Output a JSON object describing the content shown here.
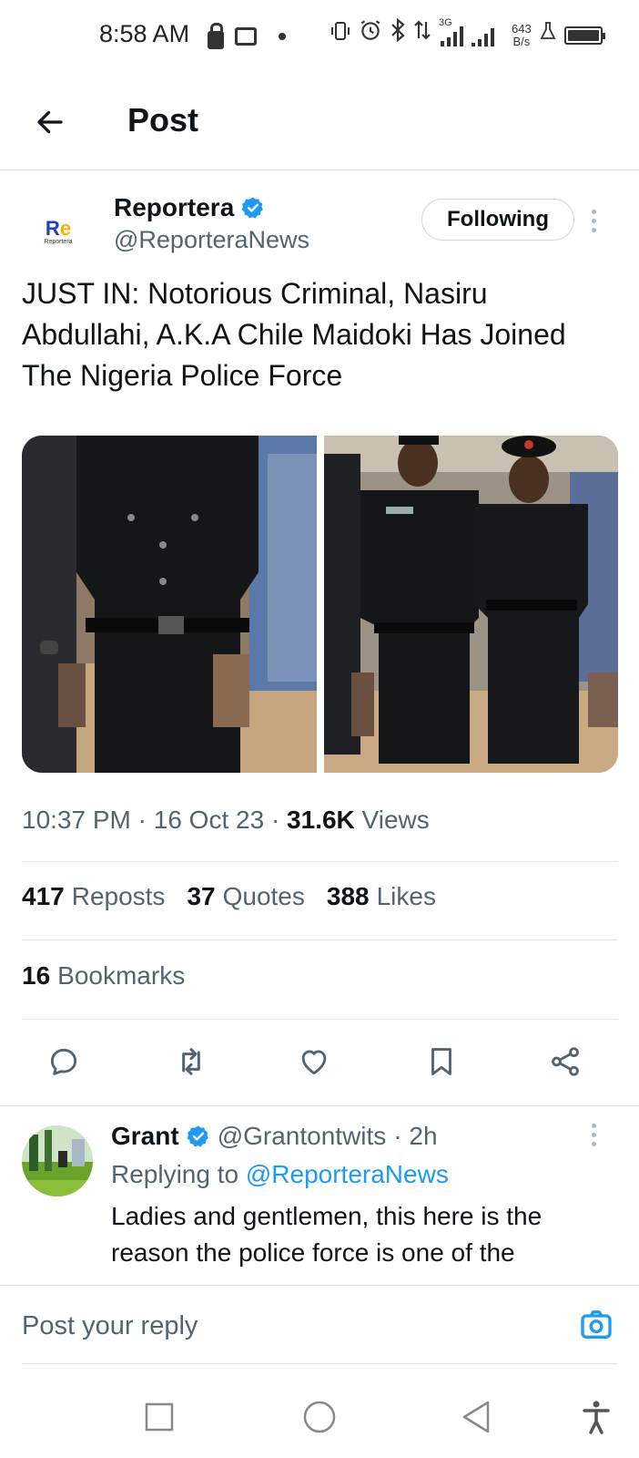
{
  "status_bar": {
    "time": "8:58 AM",
    "network_type": "3G",
    "speed_value": "643",
    "speed_unit": "B/s",
    "battery_level": 1.0
  },
  "header": {
    "title": "Post"
  },
  "post": {
    "author": {
      "name": "Reportera",
      "handle": "@ReporteraNews",
      "logo_text": "Re",
      "logo_subtext": "Reportera",
      "verified": true
    },
    "follow_label": "Following",
    "text": "JUST IN: Notorious Criminal, Nasiru Abdullahi, A.K.A Chile Maidoki Has Joined The Nigeria Police Force",
    "meta": {
      "time": "10:37 PM",
      "date": "16 Oct 23",
      "views_count": "31.6K",
      "views_label": "Views"
    },
    "stats": {
      "reposts_count": "417",
      "reposts_label": "Reposts",
      "quotes_count": "37",
      "quotes_label": "Quotes",
      "likes_count": "388",
      "likes_label": "Likes",
      "bookmarks_count": "16",
      "bookmarks_label": "Bookmarks"
    },
    "actions": [
      "reply-icon",
      "repost-icon",
      "like-icon",
      "bookmark-icon",
      "share-icon"
    ]
  },
  "reply": {
    "name": "Grant",
    "handle": "@Grantontwits",
    "age": "· 2h",
    "replying_prefix": "Replying to",
    "replying_to": "@ReporteraNews",
    "text": "Ladies and gentlemen, this here is the reason the police force is one of the"
  },
  "compose": {
    "placeholder": "Post your reply"
  },
  "colors": {
    "accent": "#1d9bf0",
    "text_primary": "#0f1419",
    "text_secondary": "#536471",
    "divider": "#dfe3e6"
  }
}
